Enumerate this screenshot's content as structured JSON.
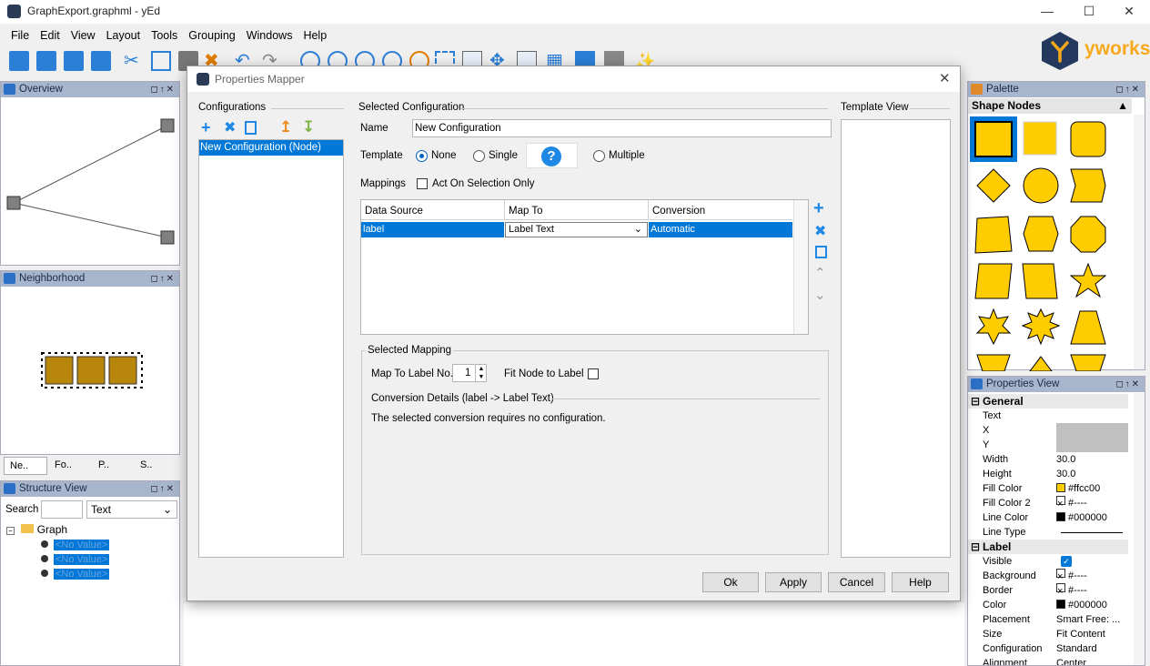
{
  "window": {
    "title": "GraphExport.graphml - yEd"
  },
  "menu": [
    "File",
    "Edit",
    "View",
    "Layout",
    "Tools",
    "Grouping",
    "Windows",
    "Help"
  ],
  "brand": {
    "name": "yworks",
    "accent": "#f7a81b"
  },
  "overview": {
    "title": "Overview"
  },
  "neighborhood": {
    "title": "Neighborhood",
    "tabs": [
      "Ne..",
      "Fo..",
      "P..",
      "S.."
    ]
  },
  "structure": {
    "title": "Structure View",
    "search_label": "Search",
    "search_value": "",
    "filter": "Text",
    "root": "Graph",
    "items": [
      "<No Value>",
      "<No Value>",
      "<No Value>"
    ]
  },
  "dialog": {
    "title": "Properties Mapper",
    "configurations_label": "Configurations",
    "config_items": [
      "New Configuration (Node)"
    ],
    "selected_config_label": "Selected Configuration",
    "name_label": "Name",
    "name_value": "New Configuration",
    "template_label": "Template",
    "opt_none": "None",
    "opt_single": "Single",
    "opt_multiple": "Multiple",
    "mappings_label": "Mappings",
    "act_on_selection": "Act On Selection Only",
    "columns": [
      "Data Source",
      "Map To",
      "Conversion"
    ],
    "rows": [
      {
        "source": "label",
        "map_to": "Label Text",
        "conversion": "Automatic"
      }
    ],
    "selected_mapping_label": "Selected Mapping",
    "map_to_label_no": "Map To Label No.",
    "label_no_value": "1",
    "fit_node": "Fit Node to Label",
    "conversion_details": "Conversion Details (label -> Label Text)",
    "conversion_message": "The selected conversion requires no configuration.",
    "template_view": "Template View",
    "buttons": {
      "ok": "Ok",
      "apply": "Apply",
      "cancel": "Cancel",
      "help": "Help"
    }
  },
  "palette": {
    "title": "Palette",
    "section": "Shape Nodes",
    "fill": "#ffcc00"
  },
  "properties": {
    "title": "Properties View",
    "general": "General",
    "rows": [
      {
        "k": "Text",
        "v": ""
      },
      {
        "k": "X",
        "v": ""
      },
      {
        "k": "Y",
        "v": ""
      },
      {
        "k": "Width",
        "v": "30.0"
      },
      {
        "k": "Height",
        "v": "30.0"
      },
      {
        "k": "Fill Color",
        "v": "#ffcc00"
      },
      {
        "k": "Fill Color 2",
        "v": "#----"
      },
      {
        "k": "Line Color",
        "v": "#000000"
      },
      {
        "k": "Line Type",
        "v": ""
      }
    ],
    "label": "Label",
    "label_rows": [
      {
        "k": "Visible",
        "v": ""
      },
      {
        "k": "Background",
        "v": "#----"
      },
      {
        "k": "Border",
        "v": "#----"
      },
      {
        "k": "Color",
        "v": "#000000"
      },
      {
        "k": "Placement",
        "v": "Smart Free: ..."
      },
      {
        "k": "Size",
        "v": "Fit Content"
      },
      {
        "k": "Configuration",
        "v": "Standard"
      },
      {
        "k": "Alignment",
        "v": "Center"
      }
    ]
  }
}
